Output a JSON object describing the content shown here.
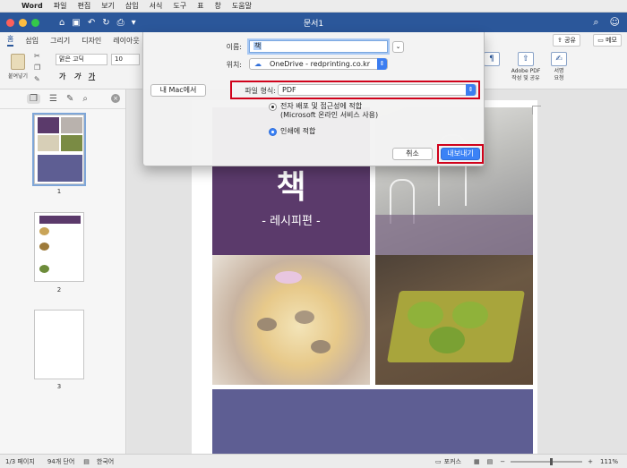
{
  "menubar": {
    "apple": "",
    "app": "Word",
    "items": [
      "파일",
      "편집",
      "보기",
      "삽입",
      "서식",
      "도구",
      "표",
      "창",
      "도움말"
    ]
  },
  "titlebar": {
    "title": "문서1"
  },
  "ribbon": {
    "tabs": [
      "홈",
      "삽입",
      "그리기",
      "디자인",
      "레이아웃"
    ],
    "share": "공유",
    "memo": "메모",
    "paste_label": "붙여넣기",
    "font_name": "맑은 고딕",
    "font_size": "10",
    "format_buttons": [
      "가",
      "가",
      "가"
    ],
    "adobe": {
      "line1": "Adobe PDF",
      "line2": "작성 및 공유"
    },
    "sign": {
      "line1": "서명",
      "line2": "요청"
    }
  },
  "sidebar": {
    "thumbnails": [
      "1",
      "2",
      "3"
    ]
  },
  "page": {
    "title": "책",
    "subtitle": "- 레시피편 -",
    "colors": {
      "purple": "#5b3a6b",
      "slate": "#5e5e93"
    }
  },
  "status": {
    "page": "1/3 페이지",
    "words": "94개 단어",
    "lang": "한국어",
    "focus": "포커스",
    "zoom": "111%"
  },
  "dialog": {
    "name_label": "이름:",
    "name_value": "책",
    "location_label": "위치:",
    "location_value": "OneDrive - redprinting.co.kr",
    "mac_button": "내 Mac에서",
    "format_label": "파일 형식:",
    "format_value": "PDF",
    "option1_line1": "전자 배포 및 접근성에 적합",
    "option1_line2": "(Microsoft 온라인 서비스 사용)",
    "option2": "인쇄에 적합",
    "cancel": "취소",
    "export": "내보내기"
  }
}
